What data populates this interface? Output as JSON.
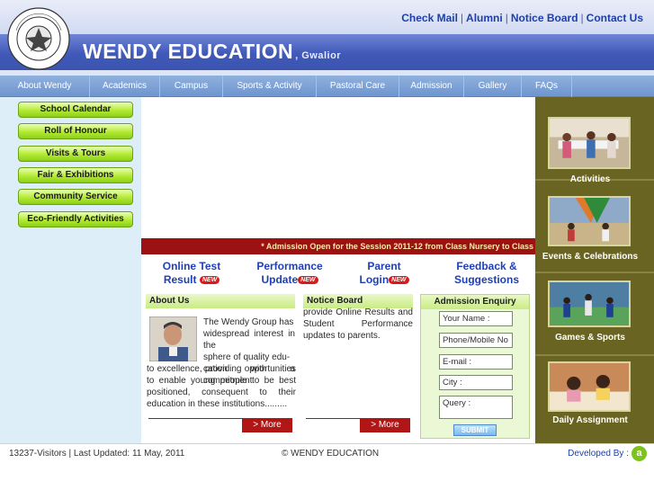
{
  "header": {
    "brand": "WENDY EDUCATION",
    "brand_city": ", Gwalior",
    "top_links": [
      "Check Mail",
      "Alumni",
      "Notice Board",
      "Contact Us"
    ],
    "separator": "|"
  },
  "nav": {
    "items": [
      "About Wendy",
      "Academics",
      "Campus",
      "Sports & Activity",
      "Pastoral Care",
      "Admission",
      "Gallery",
      "FAQs"
    ]
  },
  "left_menu": [
    "School Calendar",
    "Roll of Honour",
    "Visits & Tours",
    "Fair & Exhibitions",
    "Community Service",
    "Eco-Friendly Activities"
  ],
  "banner": "* Admission Open for the Session 2011-12 from Class Nursery to Class",
  "quick_links": [
    {
      "line1": "Online Test",
      "line2": "Result",
      "badge": "NEW"
    },
    {
      "line1": "Performance",
      "line2": "Update",
      "badge": "NEW"
    },
    {
      "line1": "Parent",
      "line2": "Login",
      "badge": "NEW"
    },
    {
      "line1": "Feedback &",
      "line2": "Suggestions",
      "badge": ""
    }
  ],
  "about": {
    "title": "About Us",
    "text_lines": [
      "The Wendy Group has",
      "widespread interest in the",
      "sphere of quality edu-",
      "cation with a commitment"
    ],
    "text_full": "to excellence, providing opportunities to enable young people to be best positioned, consequent to their education in these institutions.........",
    "more": "> More"
  },
  "notice": {
    "title": "Notice Board",
    "text": "provide Online Results and Student Performance updates to parents.",
    "more": "> More"
  },
  "enquiry": {
    "title": "Admission Enquiry",
    "fields": [
      "Your Name :",
      "Phone/Mobile No",
      "E-mail :",
      "City :",
      "Query :"
    ],
    "submit": "SUBMIT"
  },
  "right_tiles": [
    "Activities",
    "Events & Celebrations",
    "Games & Sports",
    "Daily Assignment"
  ],
  "footer": {
    "visitors": "13237-Visitors",
    "updated": "Last Updated: 11 May, 2011",
    "copyright": "© WENDY EDUCATION",
    "developed": "Developed By :",
    "dev_icon": "a"
  }
}
